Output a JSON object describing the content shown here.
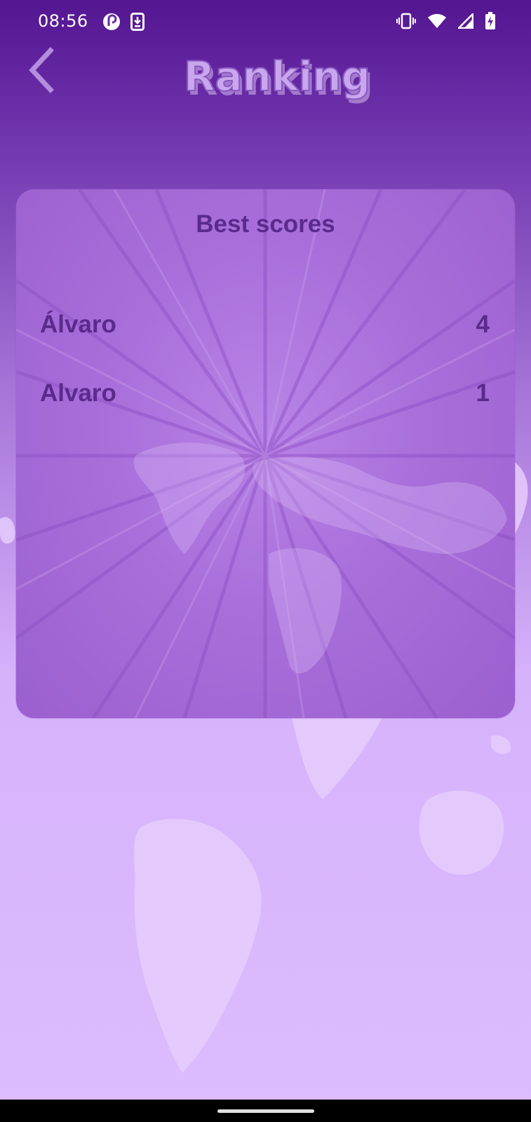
{
  "status_bar": {
    "time": "08:56",
    "left_icons": [
      "pocketcasts-icon",
      "download-icon"
    ],
    "right_icons": [
      "vibrate-icon",
      "wifi-icon",
      "signal-icon",
      "battery-charging-icon"
    ]
  },
  "header": {
    "back_icon": "chevron-left-icon",
    "title": "Ranking"
  },
  "ranking": {
    "title": "Best scores",
    "rows": [
      {
        "name": "Álvaro",
        "score": "4"
      },
      {
        "name": "Alvaro",
        "score": "1"
      }
    ]
  },
  "colors": {
    "header_top": "#541591",
    "background_bottom": "#dcbcfd",
    "card": "#a86fda",
    "text_dark_purple": "#5a2a8c",
    "title_fill": "#c7a3ec"
  }
}
